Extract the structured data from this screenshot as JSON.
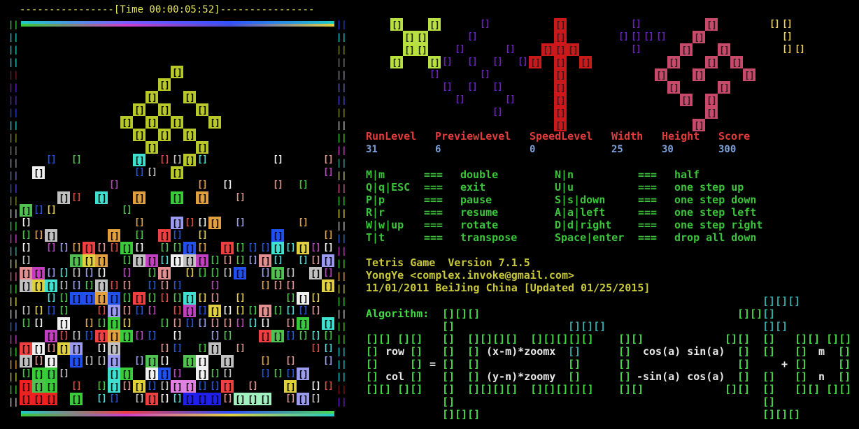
{
  "timer": {
    "text": "----------------[Time 00:00:05:52]----------------"
  },
  "stats": [
    {
      "label": "RunLevel",
      "value": "31"
    },
    {
      "label": "PreviewLevel",
      "value": "6"
    },
    {
      "label": "SpeedLevel",
      "value": "0"
    },
    {
      "label": "Width",
      "value": "25"
    },
    {
      "label": "Height",
      "value": "30"
    },
    {
      "label": "Score",
      "value": "300"
    }
  ],
  "keys_left": [
    {
      "key": "M|m",
      "sep": "===",
      "action": "double"
    },
    {
      "key": "Q|q|ESC",
      "sep": "===",
      "action": "exit"
    },
    {
      "key": "P|p",
      "sep": "===",
      "action": "pause"
    },
    {
      "key": "R|r",
      "sep": "===",
      "action": "resume"
    },
    {
      "key": "W|w|up",
      "sep": "===",
      "action": "rotate"
    },
    {
      "key": "T|t",
      "sep": "===",
      "action": "transpose"
    }
  ],
  "keys_right": [
    {
      "key": "N|n",
      "sep": "===",
      "action": "half"
    },
    {
      "key": "U|u",
      "sep": "===",
      "action": "one step up"
    },
    {
      "key": "S|s|down",
      "sep": "===",
      "action": "one step down"
    },
    {
      "key": "A|a|left",
      "sep": "===",
      "action": "one step left"
    },
    {
      "key": "D|d|right",
      "sep": "===",
      "action": "one step right"
    },
    {
      "key": "Space|enter",
      "sep": "===",
      "action": "drop all down"
    }
  ],
  "info": {
    "line1": "Tetris Game  Version 7.1.5",
    "line2": "YongYe <complex.invoke@gmail.com>",
    "line3": "11/01/2011 BeiJing China [Updated 01/25/2015]"
  },
  "algorithm": {
    "label": "Algorithm:",
    "row_label": "row",
    "col_label": "col",
    "equals": "=",
    "plus": "+",
    "expr_top": "(x-m)*zoomx",
    "expr_bottom": "(y-n)*zoomy",
    "rot_top": "cos(a) sin(a)",
    "rot_bottom": "-sin(a) cos(a)",
    "var_m": "m",
    "var_n": "n"
  },
  "colors": {
    "background": "#000000",
    "timer": "#e8e85a",
    "stat_label": "#e23b3b",
    "stat_value": "#7b9fd8",
    "keys": "#3bc43b",
    "info": "#c8c83a",
    "algorithm": "#43d843",
    "preview_green": "#b8e040",
    "preview_purple": "#6a1fcf",
    "preview_red": "#c81a1a",
    "preview_pink": "#c84a6a",
    "preview_yellow": "#e8d040"
  }
}
